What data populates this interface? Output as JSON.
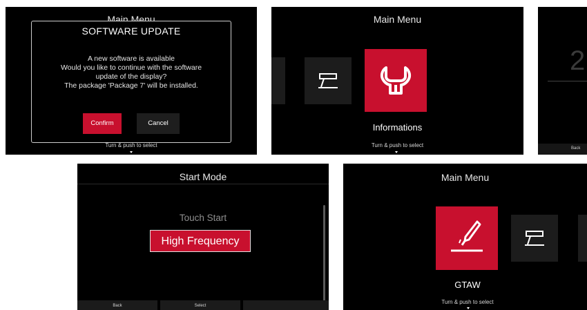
{
  "panel1": {
    "background_title": "Main Menu",
    "dialog": {
      "title": "SOFTWARE UPDATE",
      "message_lines": [
        "A new software is available",
        "Would you like to continue with the software",
        "update of the display?",
        "The package 'Package 7' will be installed."
      ],
      "confirm_label": "Confirm",
      "cancel_label": "Cancel"
    },
    "hint": "Turn & push to select"
  },
  "panel2": {
    "title": "Main Menu",
    "selected_label": "Informations",
    "hint": "Turn & push to select",
    "tiles": [
      "torch-icon",
      "tig-torch-icon",
      "wrench-icon"
    ]
  },
  "panel3": {
    "big_number": "2",
    "back_label": "Back"
  },
  "panel4": {
    "title": "Start Mode",
    "options": [
      "Touch Start",
      "High Frequency"
    ],
    "selected_option": "High Frequency",
    "footer": [
      "Back",
      "Select",
      ""
    ]
  },
  "panel5": {
    "title": "Main Menu",
    "selected_label": "GTAW",
    "hint": "Turn & push to select",
    "tiles": [
      "gtaw-torch-icon",
      "tig-torch-icon"
    ]
  },
  "colors": {
    "accent": "#c8102e",
    "background": "#000000",
    "tile": "#1c1c1c"
  }
}
